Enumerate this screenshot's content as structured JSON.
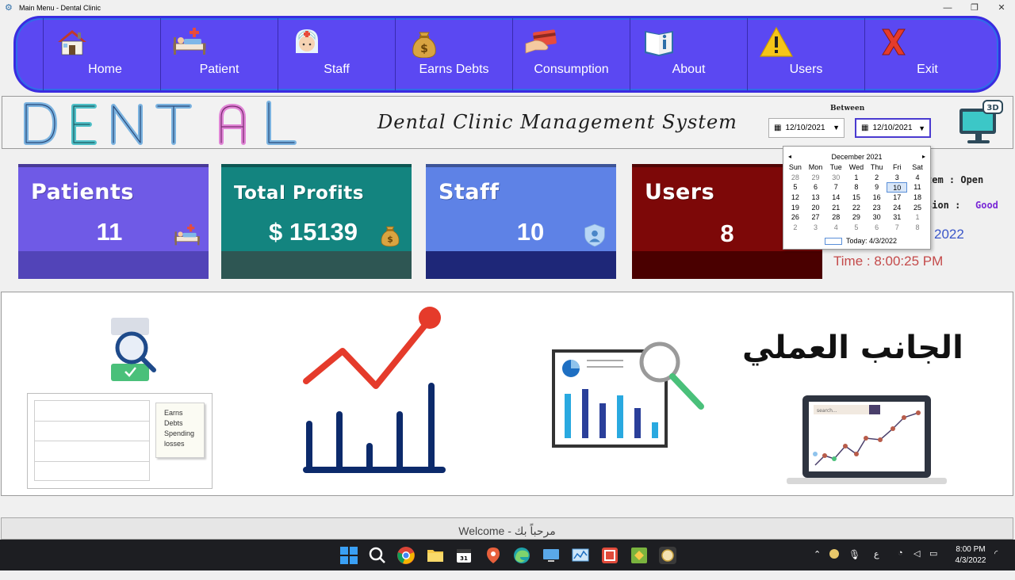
{
  "window": {
    "title": "Main Menu - Dental Clinic",
    "controls": [
      "—",
      "❐",
      "✕"
    ]
  },
  "nav": {
    "items": [
      {
        "label": "Home",
        "icon": "house-icon"
      },
      {
        "label": "Patient",
        "icon": "patient-bed-icon"
      },
      {
        "label": "Staff",
        "icon": "nurse-icon"
      },
      {
        "label": "Earns Debts",
        "icon": "money-bag-icon"
      },
      {
        "label": "Consumption",
        "icon": "card-payment-icon"
      },
      {
        "label": "About",
        "icon": "info-book-icon"
      },
      {
        "label": "Users",
        "icon": "warning-icon"
      },
      {
        "label": "Exit",
        "icon": "exit-x-icon"
      }
    ]
  },
  "header": {
    "logo_text": "DENTAL",
    "subtitle": "Dental Clinic Management System",
    "between_label": "Between",
    "date_from": "12/10/2021",
    "date_to": "12/10/2021",
    "badge_3d": "3D"
  },
  "cards": {
    "patients": {
      "title": "Patients",
      "value": "11",
      "color_top": "#6f5ae6",
      "color_bottom": "#5244b8"
    },
    "profits": {
      "title": "Total Profits",
      "value": "$ 15139",
      "color_top": "#13847f",
      "color_bottom": "#2e5653"
    },
    "staff": {
      "title": "Staff",
      "value": "10",
      "color_top": "#5e82e6",
      "color_bottom": "#1e2778"
    },
    "users": {
      "title": "Users",
      "value": "8",
      "color_top": "#7d0808",
      "color_bottom": "#4a0000"
    }
  },
  "info": {
    "system_label": "tem : Open",
    "session_label": "sion :",
    "session_value": "Good",
    "date_value": "2022",
    "time_value": "Time : 8:00:25 PM"
  },
  "calendar": {
    "month": "December 2021",
    "prev": "◂",
    "next": "▸",
    "days_of_week": [
      "Sun",
      "Mon",
      "Tue",
      "Wed",
      "Thu",
      "Fri",
      "Sat"
    ],
    "weeks": [
      [
        "28",
        "29",
        "30",
        "1",
        "2",
        "3",
        "4"
      ],
      [
        "5",
        "6",
        "7",
        "8",
        "9",
        "10",
        "11"
      ],
      [
        "12",
        "13",
        "14",
        "15",
        "16",
        "17",
        "18"
      ],
      [
        "19",
        "20",
        "21",
        "22",
        "23",
        "24",
        "25"
      ],
      [
        "26",
        "27",
        "28",
        "29",
        "30",
        "31",
        "1"
      ],
      [
        "2",
        "3",
        "4",
        "5",
        "6",
        "7",
        "8"
      ]
    ],
    "selected": "10",
    "today_label": "Today: 4/3/2022"
  },
  "panel": {
    "arabic_heading": "الجانب العملي",
    "legend_items": [
      "Earns",
      "Debts",
      "Spending",
      "losses"
    ],
    "search_placeholder": "search..."
  },
  "status": {
    "welcome": "Welcome  -  مرحباً بك"
  },
  "taskbar": {
    "lang": "ع",
    "time": "8:00 PM",
    "date": "4/3/2022"
  }
}
